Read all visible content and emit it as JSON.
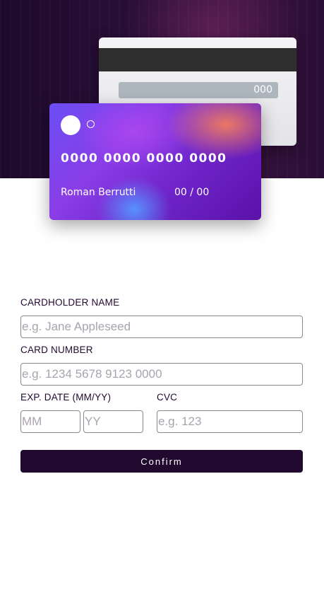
{
  "card_back": {
    "cvc": "000"
  },
  "card_front": {
    "number": "0000 0000 0000 0000",
    "holder_name": "Roman Berrutti",
    "expiry": "00 / 00"
  },
  "form": {
    "cardholder_label": "CARDHOLDER NAME",
    "cardholder_placeholder": "e.g. Jane Appleseed",
    "number_label": "CARD NUMBER",
    "number_placeholder": "e.g. 1234 5678 9123 0000",
    "exp_label": "EXP. DATE (MM/YY)",
    "mm_placeholder": "MM",
    "yy_placeholder": "YY",
    "cvc_label": "CVC",
    "cvc_placeholder": "e.g. 123",
    "confirm_label": "Confirm"
  },
  "colors": {
    "dark_violet": "#21092f",
    "border_gray": "#8e8593",
    "placeholder_gray": "#a9a3ae"
  }
}
